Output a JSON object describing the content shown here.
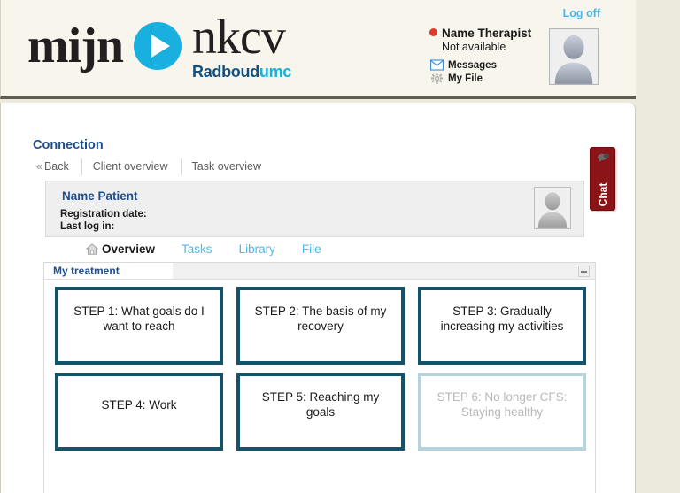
{
  "header": {
    "logo": {
      "word1": "mijn",
      "word2": "nkcv",
      "sub_main": "Radboud",
      "sub_accent": "umc",
      "play_icon": "play-icon"
    },
    "logoff_label": "Log off",
    "therapist": {
      "name": "Name Therapist",
      "status": "Not available",
      "status_color": "#e03a2f"
    },
    "links": [
      {
        "label": "Messages",
        "icon": "envelope-icon"
      },
      {
        "label": "My File",
        "icon": "gear-icon"
      }
    ],
    "avatar_icon": "user-avatar-icon"
  },
  "page": {
    "title": "Connection",
    "subtabs": [
      {
        "label": "Back",
        "chevron": "«"
      },
      {
        "label": "Client overview"
      },
      {
        "label": "Task overview"
      }
    ]
  },
  "patient": {
    "name": "Name Patient",
    "registration_label": "Registration date:",
    "lastlogin_label": "Last log in:",
    "avatar_icon": "user-avatar-icon"
  },
  "main_tabs": [
    {
      "label": "Overview",
      "active": true,
      "icon": "home-icon"
    },
    {
      "label": "Tasks",
      "active": false
    },
    {
      "label": "Library",
      "active": false
    },
    {
      "label": "File",
      "active": false
    }
  ],
  "treatment_panel": {
    "title": "My treatment",
    "minimize_icon": "minimize-icon",
    "steps": [
      {
        "label": "STEP 1: What goals do I want to reach",
        "disabled": false
      },
      {
        "label": "STEP 2: The basis of my recovery",
        "disabled": false
      },
      {
        "label": "STEP 3: Gradually increasing my activities",
        "disabled": false
      },
      {
        "label": "STEP 4: Work",
        "disabled": false
      },
      {
        "label": "STEP 5: Reaching my goals",
        "disabled": false
      },
      {
        "label": "STEP 6: No longer CFS: Staying healthy",
        "disabled": true
      }
    ]
  },
  "chat": {
    "label": "Chat",
    "icon": "speech-bubble-icon",
    "color": "#8b1418"
  },
  "colors": {
    "header_bg": "#f7f5ec",
    "page_bg": "#ece9dd",
    "accent_blue": "#4cb8e8",
    "title_blue": "#1d4f8c",
    "step_border": "#14536b",
    "step_border_disabled": "#b6d2dc"
  }
}
